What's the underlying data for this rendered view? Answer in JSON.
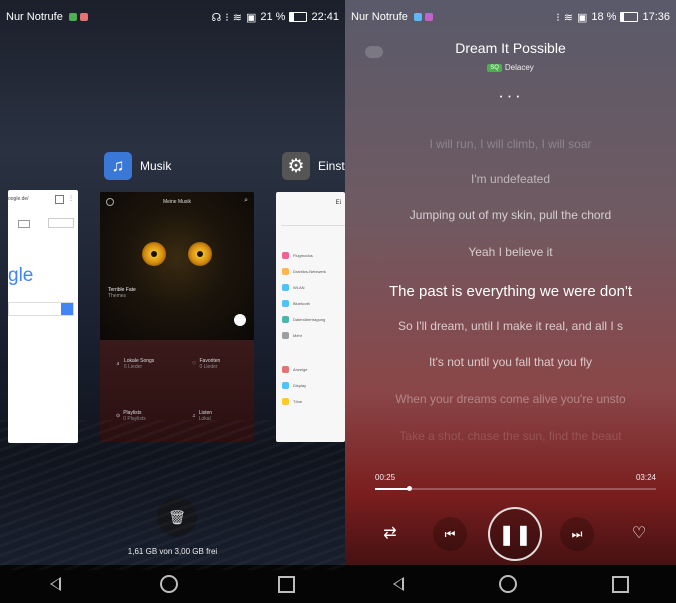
{
  "left": {
    "statusbar": {
      "carrier": "Nur Notrufe",
      "battery_pct": "21 %",
      "time": "22:41"
    },
    "apps": {
      "chrome": {
        "url_text": "oogle.de/",
        "logo_text": "gle"
      },
      "music": {
        "label": "Musik",
        "header": "Meine Musik",
        "song": "Terrible Fate",
        "song_sub": "Themes",
        "cells": [
          "Lokale Songs",
          "Favoriten",
          "Playlists",
          "Listen"
        ],
        "cells_sub": [
          "6 Lieder",
          "0 Lieder",
          "0 Playlists",
          "Lokal"
        ]
      },
      "settings": {
        "label": "Einst",
        "header": "Ei",
        "items": [
          "Flugmodus",
          "Drahtlos-Netzwerk",
          "WLAN",
          "Bluetooth",
          "Datenübertragung",
          "Mehr",
          "Anzeige",
          "Display",
          "Töne"
        ]
      }
    },
    "storage_text": "1,61 GB von 3,00 GB frei"
  },
  "right": {
    "statusbar": {
      "carrier": "Nur Notrufe",
      "battery_pct": "18 %",
      "time": "17:36"
    },
    "title": "Dream It Possible",
    "artist_badge": "SQ",
    "artist": "Delacey",
    "page_dots": "• • •",
    "lyrics": [
      {
        "text": "I will run, I will climb, I will soar",
        "opacity": 0.25
      },
      {
        "text": "I'm undefeated",
        "opacity": 0.55
      },
      {
        "text": "Jumping out of my skin, pull the chord",
        "opacity": 0.7
      },
      {
        "text": "Yeah I believe it",
        "opacity": 0.7
      },
      {
        "text": "The past is everything we were don't",
        "opacity": 1.0,
        "active": true
      },
      {
        "text": "So I'll dream, until I make it real, and all I s",
        "opacity": 0.7
      },
      {
        "text": "It's not until you fall that you fly",
        "opacity": 0.7
      },
      {
        "text": "When your dreams come alive you're unsto",
        "opacity": 0.35
      },
      {
        "text": "Take a shot, chase the sun, find the beaut",
        "opacity": 0.15
      }
    ],
    "elapsed": "00:25",
    "total": "03:24",
    "progress": 0.12
  },
  "colors": {
    "accent_music": "#3a78d8",
    "settings_icon": "#555555",
    "heart": "#ffffff"
  }
}
